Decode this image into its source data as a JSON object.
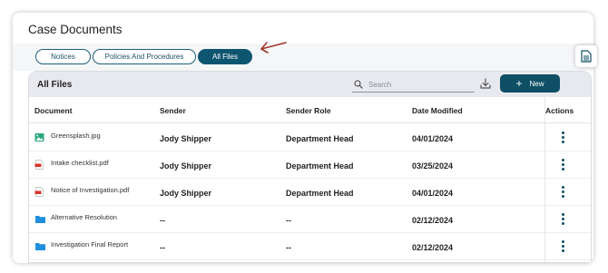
{
  "page": {
    "title": "Case Documents"
  },
  "tabs": [
    {
      "label": "Notices",
      "active": false
    },
    {
      "label": "Policies And Procedures",
      "active": false
    },
    {
      "label": "All Files",
      "active": true
    }
  ],
  "panel": {
    "title": "All Files",
    "search": {
      "placeholder": "Search",
      "value": ""
    },
    "new_label": "New"
  },
  "table": {
    "columns": [
      "Document",
      "Sender",
      "Sender Role",
      "Date Modified",
      "Actions"
    ],
    "rows": [
      {
        "document": "Greensplash.jpg",
        "icon": "image-file-icon",
        "sender": "Jody Shipper",
        "role": "Department Head",
        "date": "04/01/2024"
      },
      {
        "document": "Intake checklist.pdf",
        "icon": "pdf-file-icon",
        "sender": "Jody Shipper",
        "role": "Department Head",
        "date": "03/25/2024"
      },
      {
        "document": "Notice of Investigation.pdf",
        "icon": "pdf-file-icon",
        "sender": "Jody Shipper",
        "role": "Department Head",
        "date": "04/01/2024"
      },
      {
        "document": "Alternative Resolution",
        "icon": "folder-icon",
        "sender": "--",
        "role": "--",
        "date": "02/12/2024"
      },
      {
        "document": "Investigation Final Report",
        "icon": "folder-icon",
        "sender": "--",
        "role": "--",
        "date": "02/12/2024"
      }
    ]
  },
  "colors": {
    "accent": "#0e5670",
    "folder": "#1f8fde",
    "pdf": "#d9342b",
    "image": "#2aa77a",
    "annotation_arrow": "#a3342a"
  }
}
